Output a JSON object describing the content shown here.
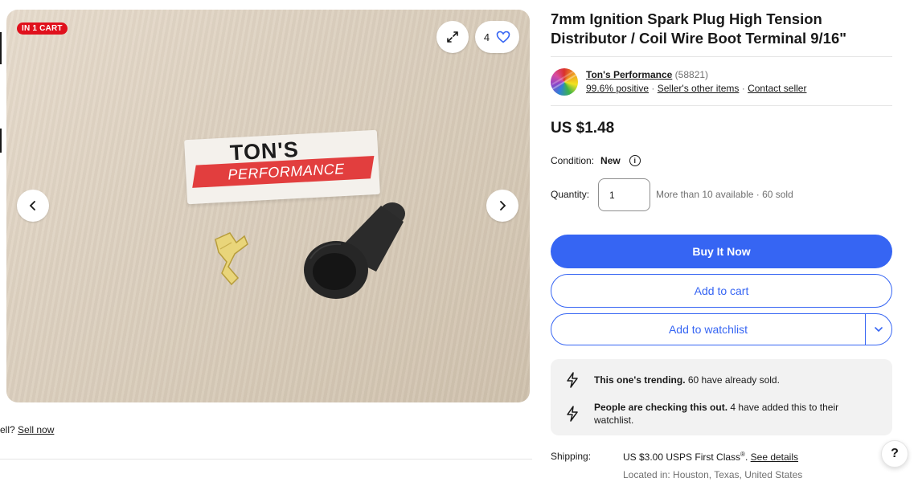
{
  "gallery": {
    "cart_badge": "IN 1 CART",
    "watch_count": "4",
    "tag_top_text": "TON'S",
    "tag_band_text": "PERFORMANCE"
  },
  "sell": {
    "prefix": "ell?",
    "link": "Sell now"
  },
  "listing": {
    "title": "7mm Ignition Spark Plug High Tension Distributor / Coil Wire Boot Terminal 9/16\"",
    "price": "US $1.48",
    "condition_label": "Condition:",
    "condition_value": "New",
    "quantity_label": "Quantity:",
    "quantity_value": "1",
    "availability": "More than 10 available · 60 sold"
  },
  "seller": {
    "name": "Ton's Performance",
    "count": "(58821)",
    "positive": "99.6% positive",
    "other_items": "Seller's other items",
    "contact": "Contact seller",
    "sep": "·"
  },
  "actions": {
    "buy_now": "Buy It Now",
    "add_cart": "Add to cart",
    "add_watch": "Add to watchlist"
  },
  "trending": [
    {
      "bold": "This one's trending.",
      "text": " 60 have already sold."
    },
    {
      "bold": "People are checking this out.",
      "text": " 4 have added this to their watchlist."
    }
  ],
  "shipping": {
    "label": "Shipping:",
    "value": "US $3.00 USPS First Class",
    "reg": "®",
    "dot": ".",
    "details": "See details",
    "location": "Located in: Houston, Texas, United States"
  },
  "help": {
    "label": "?"
  },
  "colors": {
    "primary": "#3665f3",
    "badge": "#e0101c"
  },
  "icons": {
    "expand": "expand-icon",
    "heart": "heart-icon",
    "prev": "chevron-left-icon",
    "next": "chevron-right-icon",
    "info": "info-icon",
    "chevron_down": "chevron-down-icon",
    "lightning": "lightning-icon"
  }
}
